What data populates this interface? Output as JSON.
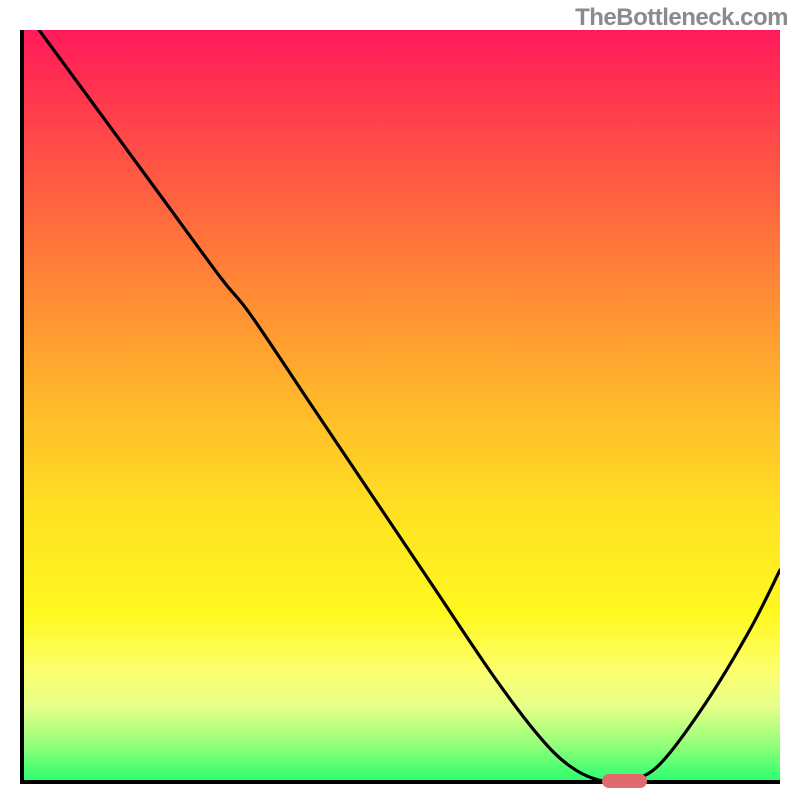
{
  "watermark": "TheBottleneck.com",
  "colors": {
    "axis": "#000000",
    "curve": "#000000",
    "marker": "#e06a6d",
    "gradient_top": "#ff1a5a",
    "gradient_bottom": "#2dff6f"
  },
  "chart_data": {
    "type": "line",
    "title": "",
    "xlabel": "",
    "ylabel": "",
    "xlim": [
      0,
      100
    ],
    "ylim": [
      0,
      100
    ],
    "x": [
      2,
      10,
      18,
      26,
      30,
      38,
      46,
      54,
      62,
      68,
      72,
      76,
      80,
      84,
      90,
      96,
      100
    ],
    "y": [
      100,
      89,
      78,
      67,
      62,
      50,
      38,
      26,
      14,
      6,
      2,
      0,
      0,
      2,
      10,
      20,
      28
    ],
    "marker": {
      "x_start": 76,
      "x_end": 82,
      "y": 0
    },
    "gradient_meaning": "vertical color gradient from red (high bottleneck) at top to green (no bottleneck) at bottom; curve shows bottleneck vs configuration parameter with minimum near x≈78"
  }
}
